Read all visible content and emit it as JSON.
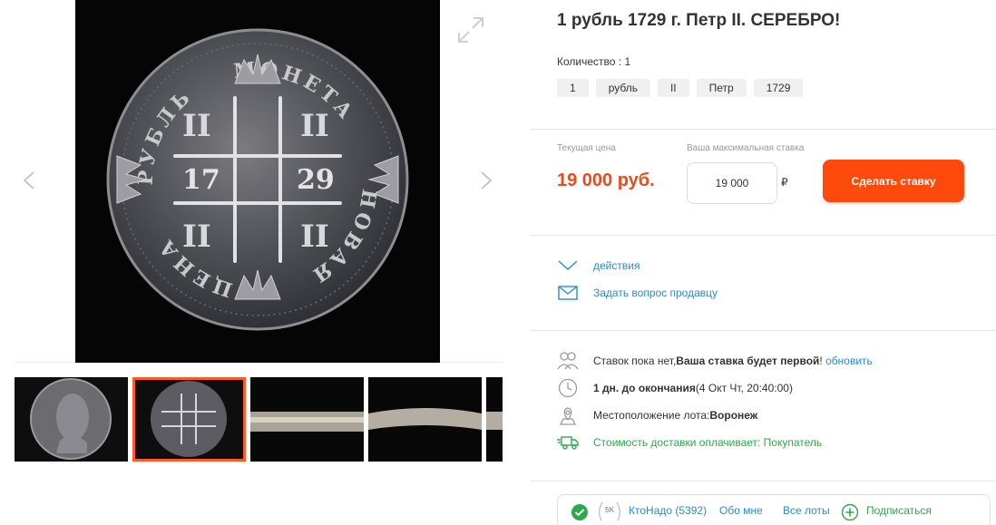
{
  "lot": {
    "title": "1 рубль 1729 г. Петр II. СЕРЕБРО!",
    "quantity": "Количество : 1",
    "tags": [
      "1",
      "рубль",
      "II",
      "Петр",
      "1729"
    ]
  },
  "coin_legend": {
    "top": "МОНЕТА",
    "right": "НОВАЯ",
    "bottom": "ЦЕНА",
    "left": "РУБЛЬ",
    "year_left": "17",
    "year_right": "29"
  },
  "bid": {
    "current_label": "Текущая цена",
    "current_price": "19 000 руб.",
    "max_label": "Ваша максимальная ставка",
    "max_value": "19 000",
    "currency": "₽",
    "button": "Сделать ставку"
  },
  "actions": {
    "actions_label": "действия",
    "ask_seller": "Задать вопрос продавцу"
  },
  "info": {
    "bids_text": "Ставок пока нет, ",
    "bids_bold": "Ваша ставка будет первой",
    "bids_excl": "!",
    "refresh": "обновить",
    "time_bold": "1 дн. до окончания",
    "time_rest": " (4 Окт Чт, 20:40:00)",
    "location_label": "Местоположение лота: ",
    "location_value": "Воронеж",
    "delivery": "Стоимость доставки оплачивает: Покупатель"
  },
  "seller": {
    "badge": "5K",
    "name": "КтоНадо (5392)",
    "about": "Обо мне",
    "all_lots": "Все лоты",
    "subscribe": "Подписаться"
  },
  "colors": {
    "accent": "#fe4a0a",
    "price": "#ea4a1e",
    "link": "#2a8bd0",
    "green": "#2da84c"
  },
  "icons": {
    "prev": "chevron-left-icon",
    "next": "chevron-right-icon",
    "expand": "expand-icon",
    "actions": "chevron-down-icon",
    "ask": "envelope-icon",
    "bids": "users-icon",
    "time": "clock-icon",
    "location": "map-pin-icon",
    "delivery": "truck-icon",
    "verified": "check-circle-icon",
    "subscribe": "plus-circle-icon"
  }
}
